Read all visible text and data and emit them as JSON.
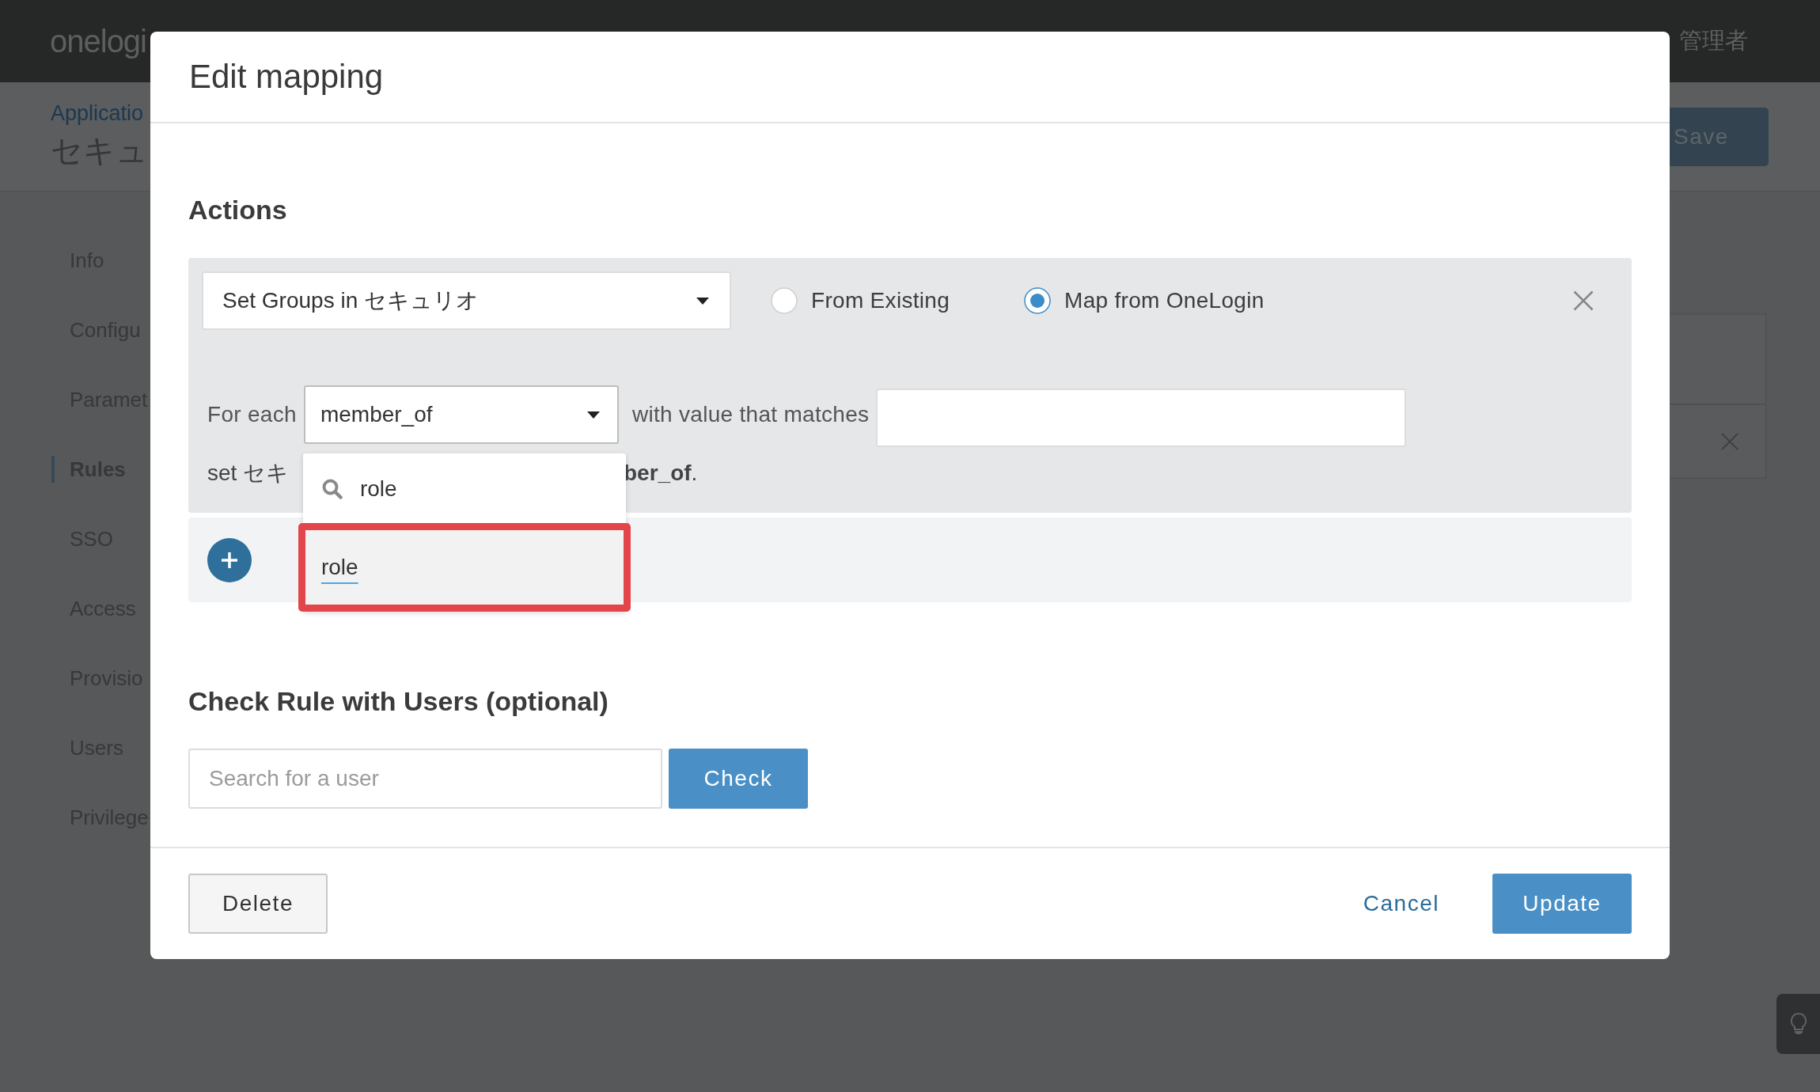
{
  "topbar": {
    "logo": "onelogi",
    "user_name": "管理者"
  },
  "page_header": {
    "breadcrumb": "Applicatio",
    "title": "セキュ",
    "save_button": "Save"
  },
  "sidebar": {
    "items": [
      {
        "label": "Info",
        "selected": false
      },
      {
        "label": "Configu",
        "selected": false
      },
      {
        "label": "Paramet",
        "selected": false
      },
      {
        "label": "Rules",
        "selected": true
      },
      {
        "label": "SSO",
        "selected": false
      },
      {
        "label": "Access",
        "selected": false
      },
      {
        "label": "Provisio",
        "selected": false
      },
      {
        "label": "Users",
        "selected": false
      },
      {
        "label": "Privilege",
        "selected": false
      }
    ]
  },
  "modal": {
    "title": "Edit mapping",
    "actions_heading": "Actions",
    "action": {
      "target_select": "Set Groups in セキュリオ",
      "source_options": [
        {
          "label": "From Existing",
          "selected": false
        },
        {
          "label": "Map from OneLogin",
          "selected": true
        }
      ],
      "for_each_label": "For each",
      "attribute_select": {
        "value": "member_of",
        "expanded": true,
        "search": "role",
        "options": [
          {
            "label": "role",
            "selected": true,
            "highlighted": true
          }
        ]
      },
      "match_label": "with value that matches",
      "summary_left": "set セキ",
      "summary_right": "**ber_of**."
    },
    "check_heading": "Check Rule with Users (optional)",
    "user_search": {
      "placeholder": "Search for a user"
    },
    "check_button": "Check",
    "delete_button": "Delete",
    "cancel_button": "Cancel",
    "update_button": "Update"
  }
}
